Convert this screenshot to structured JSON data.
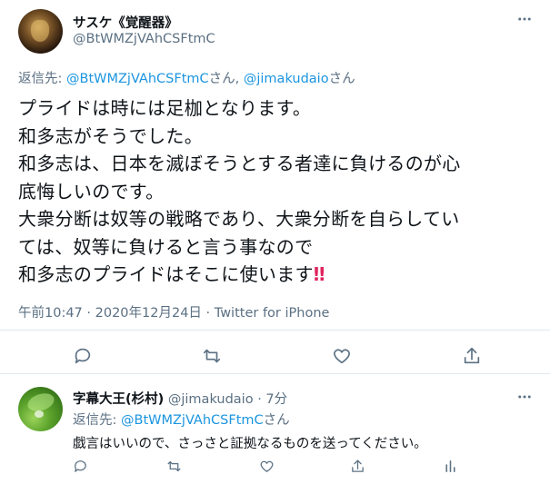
{
  "main_tweet": {
    "author_name": "サスケ《覚醒器》",
    "author_handle": "@BtWMZjVAhCSFtmC",
    "reply_prefix": "返信先: ",
    "reply_user_1": "@BtWMZjVAhCSFtmC",
    "reply_sep": "さん, ",
    "reply_user_2": "@jimakudaio",
    "reply_suffix": "さん",
    "text_lines": [
      "プライドは時には足枷となります。",
      "和多志がそうでした。",
      "和多志は、日本を滅ぼそうとする者達に負けるのが心",
      "底悔しいのです。",
      "大衆分断は奴等の戦略であり、大衆分断を自らしてい",
      "ては、奴等に負けると言う事なので",
      "和多志のプライドはそこに使います"
    ],
    "emoji": "‼",
    "meta": "午前10:47 · 2020年12月24日 · Twitter for iPhone",
    "actions": [
      "reply-icon",
      "retweet-icon",
      "like-icon",
      "share-icon"
    ]
  },
  "reply_tweet": {
    "author_name": "字幕大王(杉村)",
    "author_handle": "@jimakudaio",
    "time": "· 7分",
    "reply_prefix": "返信先: ",
    "reply_user": "@BtWMZjVAhCSFtmC",
    "reply_suffix": "さん",
    "text": "戯言はいいので、さっさと証拠なるものを送ってください。",
    "actions": [
      "reply-icon",
      "retweet-icon",
      "like-icon",
      "share-icon",
      "analytics-icon"
    ]
  },
  "colors": {
    "link": "#1b95e0",
    "secondary": "#5b7083",
    "text": "#0f1419",
    "divider": "#e1e8ed"
  }
}
